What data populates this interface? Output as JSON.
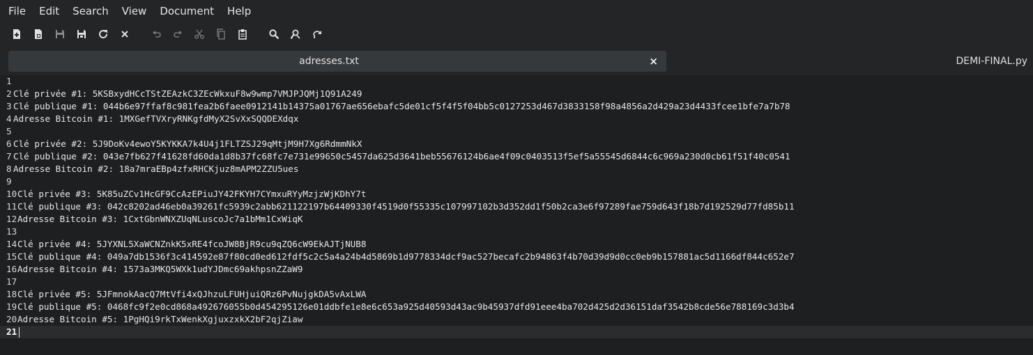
{
  "menu": [
    "File",
    "Edit",
    "Search",
    "View",
    "Document",
    "Help"
  ],
  "toolbar": [
    {
      "name": "new-file-icon"
    },
    {
      "name": "new-window-icon"
    },
    {
      "name": "save-icon"
    },
    {
      "name": "save-as-icon"
    },
    {
      "name": "reload-icon"
    },
    {
      "name": "close-icon"
    },
    {
      "name": "undo-icon"
    },
    {
      "name": "redo-icon"
    },
    {
      "name": "cut-icon"
    },
    {
      "name": "copy-icon"
    },
    {
      "name": "paste-icon"
    },
    {
      "name": "search-icon"
    },
    {
      "name": "replace-icon"
    },
    {
      "name": "goto-icon"
    }
  ],
  "tabs": {
    "active": {
      "label": "adresses.txt",
      "close": "×"
    },
    "inactive": {
      "label": "DEMI-FINAL.py"
    }
  },
  "editor": {
    "current_line": 21,
    "lines": [
      {
        "n": "1",
        "text": ""
      },
      {
        "n": "2",
        "text": "Clé privée #1: 5KSBxydHCcTStZEAzkC3ZEcWkxuF8w9wmp7VMJPJQMj1Q91A249"
      },
      {
        "n": "3",
        "text": "Clé publique #1: 044b6e97ffaf8c981fea2b6faee0912141b14375a01767ae656ebafc5de01cf5f4f5f04bb5c0127253d467d3833158f98a4856a2d429a23d4433fcee1bfe7a7b78"
      },
      {
        "n": "4",
        "text": "Adresse Bitcoin #1: 1MXGefTVXryRNKgfdMyX2SvXxSQQDEXdqx"
      },
      {
        "n": "5",
        "text": ""
      },
      {
        "n": "6",
        "text": "Clé privée #2: 5J9DoKv4ewoY5KYKKA7k4U4j1FLTZSJ29qMtjM9H7Xg6RdmmNkX"
      },
      {
        "n": "7",
        "text": "Clé publique #2: 043e7fb627f41628fd60da1d8b37fc68fc7e731e99650c5457da625d3641beb55676124b6ae4f09c0403513f5ef5a55545d6844c6c969a230d0cb61f51f40c0541"
      },
      {
        "n": "8",
        "text": "Adresse Bitcoin #2: 18a7mraEBp4zfxRHCKjuz8mAPM2ZZU5ues"
      },
      {
        "n": "9",
        "text": ""
      },
      {
        "n": "10",
        "text": "Clé privée #3: 5K85uZCv1HcGF9CcAzEPiuJY42FKYH7CYmxuRYyMzjzWjKDhY7t"
      },
      {
        "n": "11",
        "text": "Clé publique #3: 042c8202ad46eb0a39261fc5939c2abb621122197b64409330f4519d0f55335c107997102b3d352dd1f50b2ca3e6f97289fae759d643f18b7d192529d77fd85b11"
      },
      {
        "n": "12",
        "text": "Adresse Bitcoin #3: 1CxtGbnWNXZUqNLuscoJc7a1bMm1CxWiqK"
      },
      {
        "n": "13",
        "text": ""
      },
      {
        "n": "14",
        "text": "Clé privée #4: 5JYXNL5XaWCNZnkK5xRE4fcoJW8BjR9cu9qZQ6cW9EkAJTjNUB8"
      },
      {
        "n": "15",
        "text": "Clé publique #4: 049a7db1536f3c414592e87f80cd0ed612fdf5c2c5a4a24b4d5869b1d9778334dcf9ac527becafc2b94863f4b70d39d9d0cc0eb9b157881ac5d1166df844c652e7"
      },
      {
        "n": "16",
        "text": "Adresse Bitcoin #4: 1573a3MKQ5WXk1udYJDmc69akhpsnZZaW9"
      },
      {
        "n": "17",
        "text": ""
      },
      {
        "n": "18",
        "text": "Clé privée #5: 5JFmnokAacQ7MtVfi4xQJhzuLFUHjuiQRz6PvNujgkDA5vAxLWA"
      },
      {
        "n": "19",
        "text": "Clé publique #5: 0468fc9f2e0cd868a492676055b0d454295126e01ddbfe1e8e6c653a925d40593d43ac9b45937dfd91eee4ba702d425d2d36151daf3542b8cde56e788169c3d3b4"
      },
      {
        "n": "20",
        "text": "Adresse Bitcoin #5: 1PgHQi9rkTxWenkXgjuxzxkX2bF2qjZiaw"
      },
      {
        "n": "21",
        "text": ""
      }
    ]
  }
}
